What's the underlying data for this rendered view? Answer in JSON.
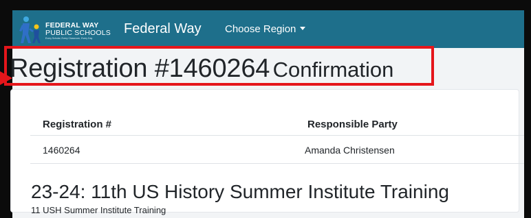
{
  "navbar": {
    "logo_line1": "FEDERAL WAY",
    "logo_line2": "PUBLIC SCHOOLS",
    "logo_tagline": "Every Scholar, Every Classroom, Every Day",
    "brand": "Federal Way",
    "region_label": "Choose Region"
  },
  "page": {
    "title": "Registration #1460264",
    "title_suffix": "Confirmation"
  },
  "registration": {
    "columns": [
      "Registration #",
      "Responsible Party"
    ],
    "row": [
      "1460264",
      "Amanda Christensen"
    ]
  },
  "course": {
    "title": "23-24: 11th US History Summer Institute Training",
    "subtitle": "11 USH Summer Institute Training"
  },
  "colors": {
    "navbar": "#1e6f8b",
    "highlight": "#e5161b"
  }
}
